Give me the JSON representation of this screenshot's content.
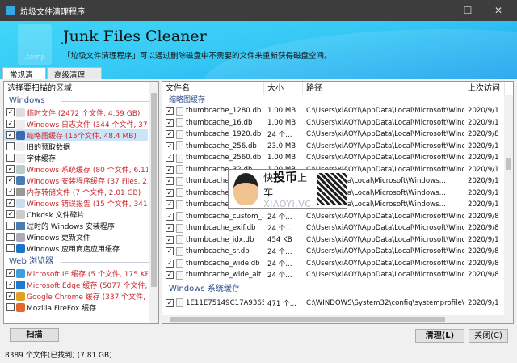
{
  "window": {
    "title": "垃圾文件清理程序",
    "minimize": "—",
    "maximize": "☐",
    "close": "✕"
  },
  "banner": {
    "app_name": "Junk Files Cleaner",
    "description": "「垃圾文件清理程序」可以通过删除磁盘中不需要的文件来重新获得磁盘空间。",
    "icon_label": ".temp"
  },
  "tabs": [
    {
      "label": "常规清理",
      "active": true
    },
    {
      "label": "高级清理",
      "active": false
    }
  ],
  "left": {
    "header": "选择要扫描的区域",
    "groups": [
      {
        "label": "Windows",
        "items": [
          {
            "label": "临时文件 (2472 个文件, 4.59 GB)",
            "checked": true,
            "highlight": true,
            "icon": "temp-files-icon"
          },
          {
            "label": "Windows 日志文件 (344 个文件, 37...",
            "checked": true,
            "highlight": true,
            "icon": "log-file-icon"
          },
          {
            "label": "缩略图缓存 (15个文件, 48.4 MB)",
            "checked": true,
            "highlight": true,
            "selected": true,
            "icon": "thumbnail-icon"
          },
          {
            "label": "旧的预取数据",
            "checked": false,
            "icon": "prefetch-icon"
          },
          {
            "label": "字体缓存",
            "checked": false,
            "icon": "font-icon"
          },
          {
            "label": "Windows 系统缓存 (80 个文件, 6.11...",
            "checked": true,
            "highlight": true,
            "icon": "system-cache-icon"
          },
          {
            "label": "Windows 安装程序缓存 (37 Files, 23...",
            "checked": true,
            "highlight": true,
            "icon": "installer-icon"
          },
          {
            "label": "内存转储文件 (7 个文件, 2.01 GB)",
            "checked": true,
            "highlight": true,
            "icon": "memory-dump-icon"
          },
          {
            "label": "Windows 错误报告 (15 个文件, 341 ...",
            "checked": true,
            "highlight": true,
            "icon": "error-report-icon"
          },
          {
            "label": "Chkdsk 文件碎片",
            "checked": true,
            "icon": "chkdsk-icon"
          },
          {
            "label": "过时的 Windows 安装程序",
            "checked": false,
            "icon": "old-installer-icon"
          },
          {
            "label": "Windows 更新文件",
            "checked": false,
            "icon": "windows-update-icon"
          },
          {
            "label": "Windows 应用商店应用缓存",
            "checked": false,
            "icon": "store-icon"
          }
        ]
      },
      {
        "label": "Web 浏览器",
        "items": [
          {
            "label": "Microsoft IE 缓存 (5 个文件, 175 KB)",
            "checked": true,
            "highlight": true,
            "icon": "ie-icon"
          },
          {
            "label": "Microsoft Edge 缓存 (5077 个文件, 5..",
            "checked": true,
            "highlight": true,
            "icon": "edge-icon"
          },
          {
            "label": "Google Chrome 缓存 (337 个文件, 22.",
            "checked": true,
            "highlight": true,
            "icon": "chrome-icon"
          },
          {
            "label": "Mozilla FireFox 缓存",
            "checked": false,
            "icon": "firefox-icon"
          }
        ]
      }
    ]
  },
  "table": {
    "columns": [
      "文件名",
      "大小",
      "路径",
      "上次访问"
    ],
    "groups": [
      {
        "label": "缩略图缓存",
        "rows": [
          [
            "thumbcache_1280.db",
            "1.00 MB",
            "C:\\Users\\xiAOYI\\AppData\\Local\\Microsoft\\Windows...",
            "2020/9/1"
          ],
          [
            "thumbcache_16.db",
            "1.00 MB",
            "C:\\Users\\xiAOYI\\AppData\\Local\\Microsoft\\Windows...",
            "2020/9/1"
          ],
          [
            "thumbcache_1920.db",
            "24 个...",
            "C:\\Users\\xiAOYI\\AppData\\Local\\Microsoft\\Windows...",
            "2020/9/8"
          ],
          [
            "thumbcache_256.db",
            "23.0 MB",
            "C:\\Users\\xiAOYI\\AppData\\Local\\Microsoft\\Windows...",
            "2020/9/1"
          ],
          [
            "thumbcache_2560.db",
            "1.00 MB",
            "C:\\Users\\xiAOYI\\AppData\\Local\\Microsoft\\Windows...",
            "2020/9/1"
          ],
          [
            "thumbcache_32.db",
            "1.00 MB",
            "C:\\Users\\xiAOYI\\AppData\\Local\\Microsoft\\Windows...",
            "2020/9/1"
          ],
          [
            "thumbcache_",
            "",
            "...YI\\AppData\\Local\\Microsoft\\Windows...",
            "2020/9/1"
          ],
          [
            "thumbcache_",
            "",
            "...YI\\AppData\\Local\\Microsoft\\Windows...",
            "2020/9/1"
          ],
          [
            "thumbcache_",
            "",
            "...YI\\AppData\\Local\\Microsoft\\Windows...",
            "2020/9/1"
          ],
          [
            "thumbcache_custom_...",
            "24 个...",
            "C:\\Users\\xiAOYI\\AppData\\Local\\Microsoft\\Windows...",
            "2020/9/8"
          ],
          [
            "thumbcache_exif.db",
            "24 个...",
            "C:\\Users\\xiAOYI\\AppData\\Local\\Microsoft\\Windows...",
            "2020/9/8"
          ],
          [
            "thumbcache_idx.db",
            "454 KB",
            "C:\\Users\\xiAOYI\\AppData\\Local\\Microsoft\\Windows...",
            "2020/9/1"
          ],
          [
            "thumbcache_sr.db",
            "24 个...",
            "C:\\Users\\xiAOYI\\AppData\\Local\\Microsoft\\Windows...",
            "2020/9/8"
          ],
          [
            "thumbcache_wide.db",
            "24 个...",
            "C:\\Users\\xiAOYI\\AppData\\Local\\Microsoft\\Windows...",
            "2020/9/8"
          ],
          [
            "thumbcache_wide_alt...",
            "24 个...",
            "C:\\Users\\xiAOYI\\AppData\\Local\\Microsoft\\Windows...",
            "2020/9/8"
          ]
        ]
      },
      {
        "label": "Windows 系统缓存",
        "rows": [
          [
            "1E11E75149C17A9365...",
            "471 个...",
            "C:\\WINDOWS\\System32\\config\\systemprofile\\App...",
            "2020/9/1"
          ]
        ]
      }
    ]
  },
  "watermark": {
    "text1a": "快",
    "text1b": "投币",
    "text1c": "上车",
    "text2": "XIAOYI.VC"
  },
  "buttons": {
    "scan": "扫描",
    "clean": "清理(L)",
    "close": "关闭(C)"
  },
  "status": "8389  个文件(已找到) (7.81 GB)",
  "colors": {
    "highlight": "#c8282e",
    "group": "#2a4a8a",
    "banner": "#35c8f5",
    "titlebar": "#3d3d3d"
  }
}
